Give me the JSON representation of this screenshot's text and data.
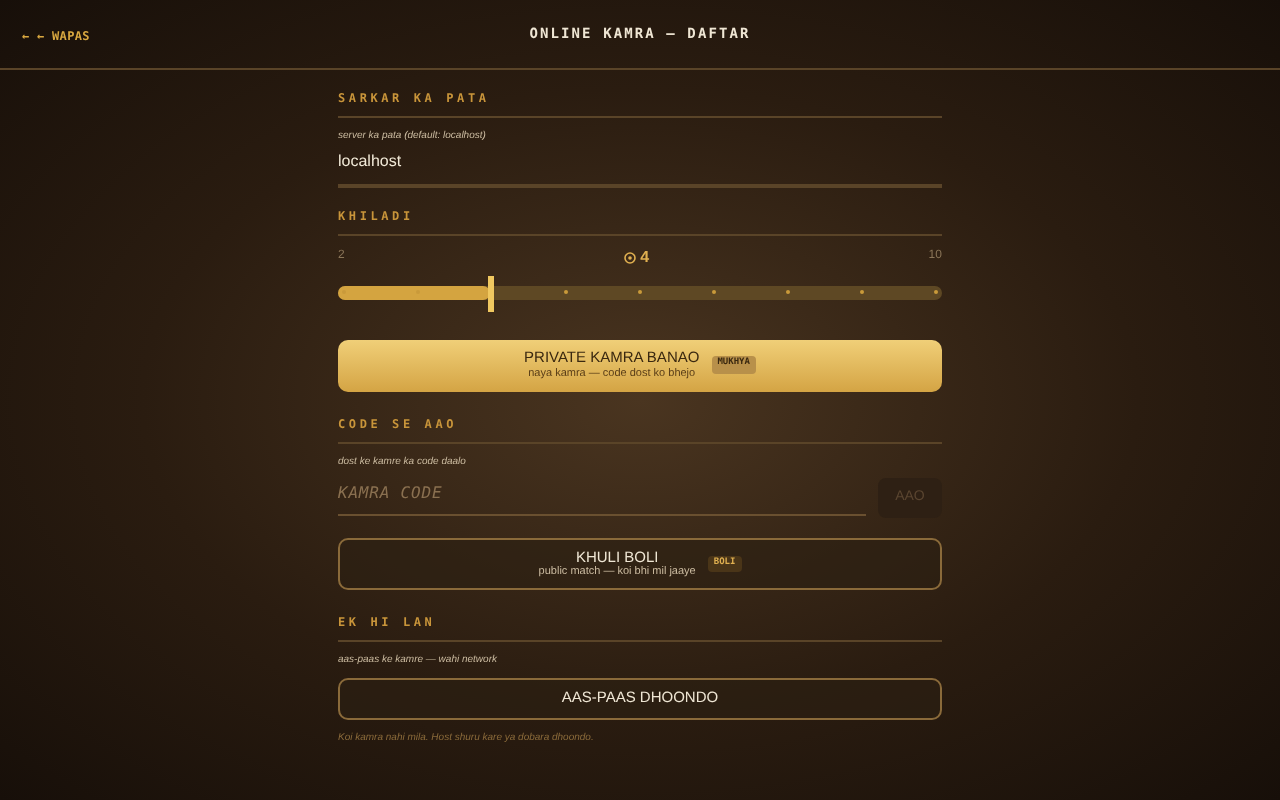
{
  "back_link": "← ← WAPAS",
  "title": "ONLINE KAMRA — DAFTAR",
  "server": {
    "heading": "SARKAR KA PATA",
    "hint": "server ka pata (default: localhost)",
    "value": "localhost"
  },
  "players": {
    "heading": "KHILADI",
    "min": "2",
    "max": "10",
    "reading": "4",
    "level": 0.25
  },
  "private_button": {
    "label": "PRIVATE KAMRA BANAO",
    "sub": "naya kamra — code dost ko bhejo",
    "badge": "MUKHYA"
  },
  "join": {
    "heading": "CODE SE AAO",
    "hint": "dost ke kamre ka code daalo",
    "placeholder": "KAMRA CODE",
    "button": "AAO",
    "button_disabled": true
  },
  "public_button": {
    "label": "KHULI BOLI",
    "sub": "public match — koi bhi mil jaaye",
    "badge": "BOLI"
  },
  "lan": {
    "heading": "EK HI LAN",
    "hint": "aas-paas ke kamre — wahi network",
    "button": "AAS-PAAS DHOONDO",
    "status": "Koi kamra nahi mila. Host shuru kare ya dobara dhoondo."
  }
}
